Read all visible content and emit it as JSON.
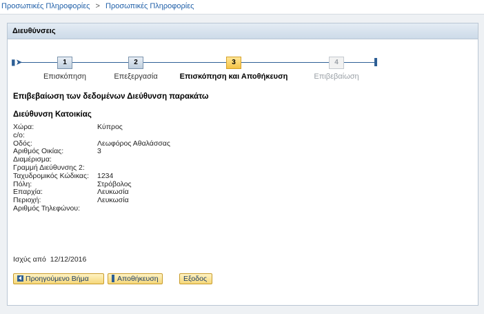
{
  "breadcrumb": {
    "items": [
      "Προσωπικές Πληροφορίες",
      "Προσωπικές Πληροφορίες"
    ],
    "separator": ">"
  },
  "panel": {
    "title": "Διευθύνσεις"
  },
  "roadmap": {
    "steps": [
      {
        "number": "1",
        "label": "Επισκόπηση",
        "state": "done"
      },
      {
        "number": "2",
        "label": "Επεξεργασία",
        "state": "done"
      },
      {
        "number": "3",
        "label": "Επισκόπηση και Αποθήκευση",
        "state": "active"
      },
      {
        "number": "4",
        "label": "Επιβεβαίωση",
        "state": "disabled"
      }
    ]
  },
  "confirm_title": "Επιβεβαίωση των δεδομένων Διεύθυνση παρακάτω",
  "section_title": "Διεύθυνση Κατοικίας",
  "fields": [
    {
      "label": "Χώρα:",
      "value": "Κύπρος"
    },
    {
      "label": "c/o:",
      "value": ""
    },
    {
      "label": "Οδός:",
      "value": "Λεωφόρος Αθαλάσσας"
    },
    {
      "label": "Αριθμός Οικίας:",
      "value": "3"
    },
    {
      "label": "Διαμέρισμα:",
      "value": ""
    },
    {
      "label": "Γραμμή Διεύθυνσης 2:",
      "value": ""
    },
    {
      "label": "Ταχυδρομικός Κώδικας:",
      "value": "1234"
    },
    {
      "label": "Πόλη:",
      "value": "Στρόβολος"
    },
    {
      "label": "Επαρχία:",
      "value": "Λευκωσία"
    },
    {
      "label": "Περιοχή:",
      "value": "Λευκωσία"
    },
    {
      "label": "Αριθμός Τηλεφώνου:",
      "value": ""
    }
  ],
  "valid_from": {
    "label": "Ισχύς από",
    "date": "12/12/2016"
  },
  "buttons": {
    "previous": "Προηγούμενο Βήμα",
    "save": "Αποθήκευση",
    "exit": "Εξοδος"
  },
  "colors": {
    "link": "#1f5fa8",
    "roadmap_line": "#2e5f95",
    "active_step": "#f5c447",
    "button_bg": "#f5d77a"
  }
}
